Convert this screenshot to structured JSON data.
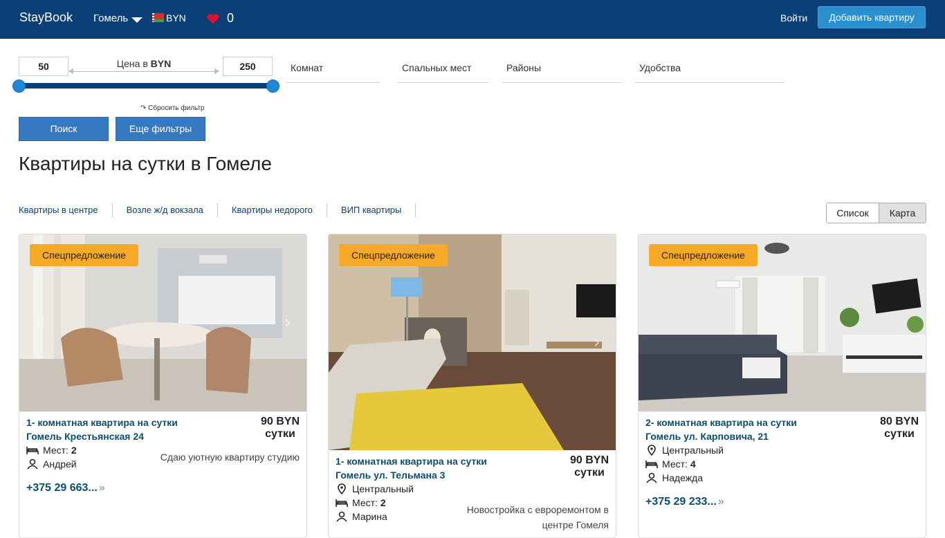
{
  "header": {
    "logo": "StayBook",
    "city": "Гомель",
    "currency": "BYN",
    "favorites_count": "0",
    "login": "Войти",
    "add_button": "Добавить квартиру"
  },
  "filters": {
    "price_min": "50",
    "price_max": "250",
    "price_label_prefix": "Цена в ",
    "price_label_currency": "BYN",
    "reset": "↷ Сбросить фильтр",
    "rooms": "Комнат",
    "beds": "Спальных мест",
    "districts": "Районы",
    "amenities": "Удобства",
    "search_button": "Поиск",
    "more_filters_button": "Еще фильтры"
  },
  "page_title": "Квартиры на сутки в Гомеле",
  "quick_links": [
    "Квартиры в центре",
    "Возле ж/д вокзала",
    "Квартиры недорого",
    "ВИП квартиры"
  ],
  "view_toggle": {
    "list": "Список",
    "map": "Карта"
  },
  "listings": [
    {
      "badge": "Спецпредложение",
      "title_line1": "1- комнатная квартира на сутки",
      "title_line2": "Гомель Крестьянская 24",
      "price": "90 BYN",
      "price_unit": "сутки",
      "places_label": "Мест:",
      "places": "2",
      "host": "Андрей",
      "description": "Сдаю уютную квартиру студию",
      "phone": "+375 29 663..."
    },
    {
      "badge": "Спецпредложение",
      "title_line1": "1- комнатная квартира на сутки",
      "title_line2": "Гомель ул. Тельмана 3",
      "price": "90 BYN",
      "price_unit": "сутки",
      "district": "Центральный",
      "places_label": "Мест:",
      "places": "2",
      "host": "Марина",
      "description_line1": "Новостройка с евроремонтом в",
      "description_line2": "центре Гомеля"
    },
    {
      "badge": "Спецпредложение",
      "title_line1": "2- комнатная квартира на сутки",
      "title_line2": "Гомель ул. Карповича, 21",
      "price": "80 BYN",
      "price_unit": "сутки",
      "district": "Центральный",
      "places_label": "Мест:",
      "places": "4",
      "host": "Надежда",
      "phone": "+375 29 233..."
    }
  ],
  "icons": {
    "map_pin": "map-pin-icon",
    "bed": "bed-icon",
    "user": "user-icon",
    "heart": "heart-icon",
    "chevron": "double-chevron-icon"
  },
  "colors": {
    "header_bg": "#0b3f78",
    "add_button_bg": "#2a8fcf",
    "badge_bg": "#f7a928",
    "link": "#0b4d6e",
    "slider": "#1e88d6"
  }
}
